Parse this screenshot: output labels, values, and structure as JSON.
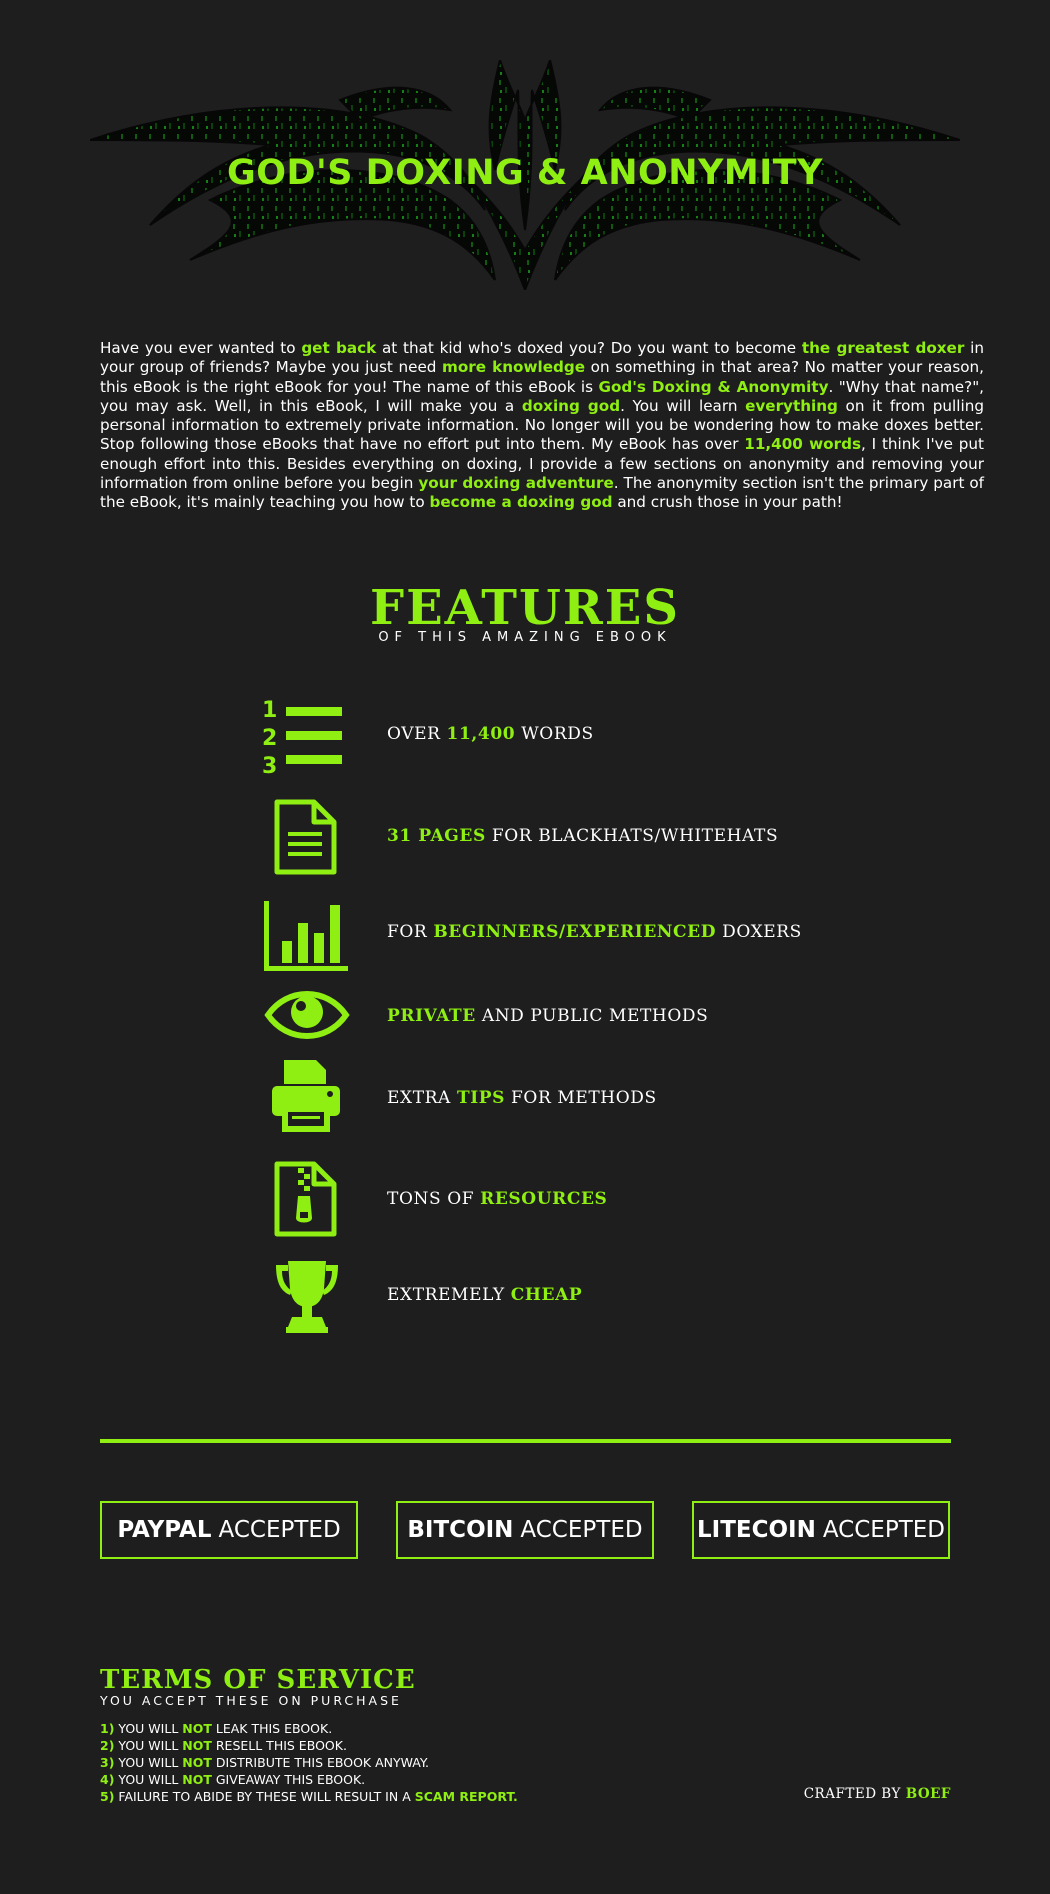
{
  "colors": {
    "accent": "#8fef13",
    "background": "#1e1e1e",
    "text": "#ffffff"
  },
  "header": {
    "title": "GOD'S DOXING & ANONYMITY",
    "decoration": "tribal-graphic"
  },
  "intro": {
    "segments": [
      {
        "text": "Have you ever wanted to ",
        "highlight": false
      },
      {
        "text": "get back",
        "highlight": true
      },
      {
        "text": " at that kid who's doxed you? Do you want to become ",
        "highlight": false
      },
      {
        "text": "the greatest doxer",
        "highlight": true
      },
      {
        "text": " in your group of friends? Maybe you just need ",
        "highlight": false
      },
      {
        "text": "more knowledge",
        "highlight": true
      },
      {
        "text": " on something in that area? No matter your reason, this eBook is the right eBook for you! The name of this eBook is ",
        "highlight": false
      },
      {
        "text": "God's Doxing & Anonymity",
        "highlight": true
      },
      {
        "text": ". \"Why that name?\", you may ask. Well, in this eBook, I will make you a ",
        "highlight": false
      },
      {
        "text": "doxing god",
        "highlight": true
      },
      {
        "text": ". You will learn ",
        "highlight": false
      },
      {
        "text": "everything",
        "highlight": true
      },
      {
        "text": " on it from pulling personal information to extremely private information. No longer will you be wondering how to make doxes better. Stop following those eBooks that have no effort put into them. My eBook has over ",
        "highlight": false
      },
      {
        "text": "11,400 words",
        "highlight": true
      },
      {
        "text": ", I think I've put enough effort into this. Besides everything on doxing, I provide a few sections on anonymity and removing your information from online before you begin ",
        "highlight": false
      },
      {
        "text": "your doxing adventure",
        "highlight": true
      },
      {
        "text": ". The anonymity section isn't the primary part of the eBook, it's mainly teaching you how to ",
        "highlight": false
      },
      {
        "text": "become a doxing god",
        "highlight": true
      },
      {
        "text": " and crush those in your path!",
        "highlight": false
      }
    ]
  },
  "features": {
    "title": "FEATURES",
    "subtitle": "OF THIS AMAZING EBOOK",
    "items": [
      {
        "icon": "numbered-list-icon",
        "segments": [
          {
            "text": "OVER ",
            "highlight": false
          },
          {
            "text": "11,400",
            "highlight": true
          },
          {
            "text": " WORDS",
            "highlight": false
          }
        ]
      },
      {
        "icon": "document-icon",
        "segments": [
          {
            "text": "31 PAGES",
            "highlight": true
          },
          {
            "text": " FOR BLACKHATS/WHITEHATS",
            "highlight": false
          }
        ]
      },
      {
        "icon": "bar-chart-icon",
        "segments": [
          {
            "text": "FOR ",
            "highlight": false
          },
          {
            "text": "BEGINNERS/EXPERIENCED",
            "highlight": true
          },
          {
            "text": " DOXERS",
            "highlight": false
          }
        ]
      },
      {
        "icon": "eye-icon",
        "segments": [
          {
            "text": "PRIVATE",
            "highlight": true
          },
          {
            "text": " AND PUBLIC METHODS",
            "highlight": false
          }
        ]
      },
      {
        "icon": "printer-icon",
        "segments": [
          {
            "text": "EXTRA ",
            "highlight": false
          },
          {
            "text": "TIPS",
            "highlight": true
          },
          {
            "text": " FOR METHODS",
            "highlight": false
          }
        ]
      },
      {
        "icon": "zip-file-icon",
        "segments": [
          {
            "text": "TONS OF ",
            "highlight": false
          },
          {
            "text": "RESOURCES",
            "highlight": true
          }
        ]
      },
      {
        "icon": "trophy-icon",
        "segments": [
          {
            "text": "EXTREMELY ",
            "highlight": false
          },
          {
            "text": "CHEAP",
            "highlight": true
          }
        ]
      }
    ]
  },
  "payments": [
    {
      "name": "PAYPAL",
      "label": "ACCEPTED"
    },
    {
      "name": "BITCOIN",
      "label": "ACCEPTED"
    },
    {
      "name": "LITECOIN",
      "label": "ACCEPTED"
    }
  ],
  "terms": {
    "title": "TERMS OF SERVICE",
    "subtitle": "YOU ACCEPT THESE ON PURCHASE",
    "items": [
      {
        "num": "1)",
        "segments": [
          {
            "text": " YOU WILL ",
            "highlight": false
          },
          {
            "text": "NOT",
            "highlight": true
          },
          {
            "text": " LEAK THIS EBOOK.",
            "highlight": false
          }
        ]
      },
      {
        "num": "2)",
        "segments": [
          {
            "text": " YOU WILL ",
            "highlight": false
          },
          {
            "text": "NOT",
            "highlight": true
          },
          {
            "text": " RESELL THIS EBOOK.",
            "highlight": false
          }
        ]
      },
      {
        "num": "3)",
        "segments": [
          {
            "text": " YOU WILL ",
            "highlight": false
          },
          {
            "text": "NOT",
            "highlight": true
          },
          {
            "text": " DISTRIBUTE THIS EBOOK ANYWAY.",
            "highlight": false
          }
        ]
      },
      {
        "num": "4)",
        "segments": [
          {
            "text": " YOU WILL ",
            "highlight": false
          },
          {
            "text": "NOT",
            "highlight": true
          },
          {
            "text": " GIVEAWAY THIS EBOOK.",
            "highlight": false
          }
        ]
      },
      {
        "num": "5)",
        "segments": [
          {
            "text": " FAILURE TO ABIDE BY THESE WILL RESULT IN A ",
            "highlight": false
          },
          {
            "text": "SCAM REPORT.",
            "highlight": true
          }
        ]
      }
    ]
  },
  "footer": {
    "crafted_prefix": "CRAFTED BY ",
    "author": "BOEF"
  }
}
